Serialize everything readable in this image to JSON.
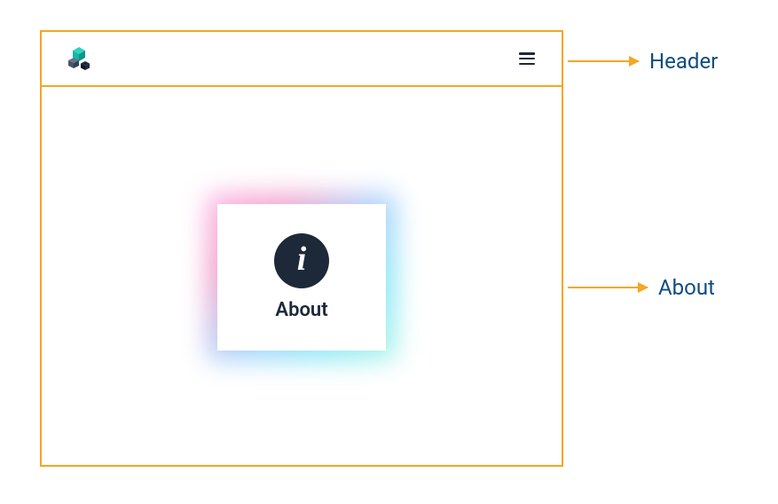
{
  "annotations": {
    "header_label": "Header",
    "about_label": "About"
  },
  "card": {
    "about_text": "About",
    "info_glyph": "i"
  },
  "icons": {
    "logo": "cubes-logo",
    "menu": "hamburger-menu-icon",
    "info": "info-icon"
  }
}
